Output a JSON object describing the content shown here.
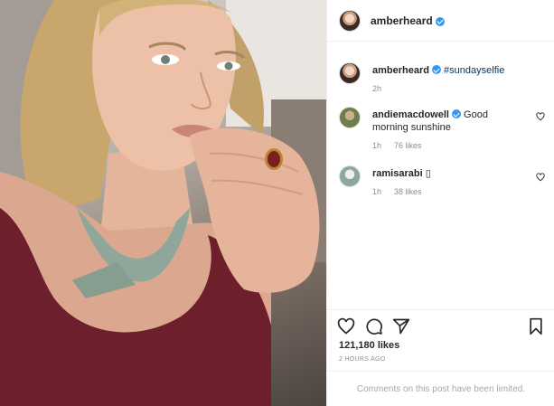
{
  "post": {
    "author": "amberheard",
    "caption_hashtag": "#sundayselfie",
    "caption_time": "2h",
    "comments": [
      {
        "author": "andiemacdowell",
        "text": "Good morning sunshine",
        "time": "1h",
        "likes": "76 likes"
      },
      {
        "author": "ramisarabi",
        "text": "▯",
        "time": "1h",
        "likes": "38 likes"
      }
    ],
    "like_count": "121,180 likes",
    "posted_ago": "2 HOURS AGO",
    "comments_limited_notice": "Comments on this post have been limited.",
    "icons": {
      "verified": "verified-badge-icon",
      "like": "heart-icon",
      "comment": "comment-bubble-icon",
      "share": "paper-plane-icon",
      "save": "bookmark-icon"
    },
    "colors": {
      "verified": "#3897f0",
      "hashtag": "#00376b",
      "muted": "#8e8e8e",
      "border": "#efefef"
    }
  }
}
